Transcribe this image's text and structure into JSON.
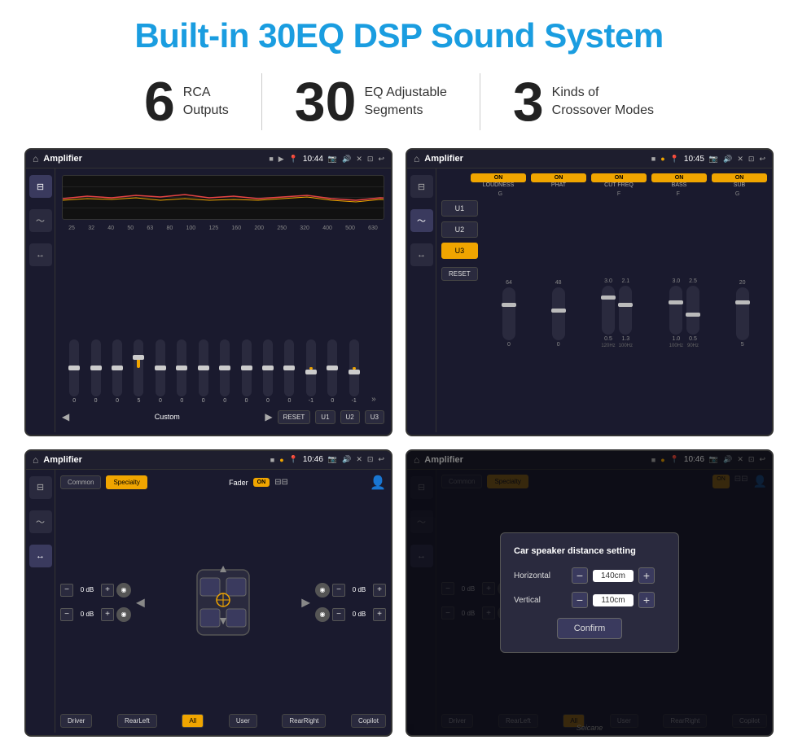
{
  "page": {
    "title": "Built-in 30EQ DSP Sound System",
    "background_color": "#ffffff"
  },
  "features": [
    {
      "number": "6",
      "text_line1": "RCA",
      "text_line2": "Outputs"
    },
    {
      "number": "30",
      "text_line1": "EQ Adjustable",
      "text_line2": "Segments"
    },
    {
      "number": "3",
      "text_line1": "Kinds of",
      "text_line2": "Crossover Modes"
    }
  ],
  "screens": {
    "top_left": {
      "header": {
        "app": "Amplifier",
        "time": "10:44"
      },
      "eq_labels": [
        "25",
        "32",
        "40",
        "50",
        "63",
        "80",
        "100",
        "125",
        "160",
        "200",
        "250",
        "320",
        "400",
        "500",
        "630"
      ],
      "presets": [
        "Custom",
        "RESET",
        "U1",
        "U2",
        "U3"
      ],
      "slider_values": [
        "0",
        "0",
        "0",
        "5",
        "0",
        "0",
        "0",
        "0",
        "0",
        "0",
        "0",
        "-1",
        "0",
        "-1"
      ]
    },
    "top_right": {
      "header": {
        "app": "Amplifier",
        "time": "10:45"
      },
      "u_buttons": [
        "U1",
        "U2",
        "U3"
      ],
      "active_u": "U3",
      "controls": [
        {
          "label": "LOUDNESS",
          "toggle": "ON"
        },
        {
          "label": "PHAT",
          "toggle": "ON"
        },
        {
          "label": "CUT FREQ",
          "toggle": "ON"
        },
        {
          "label": "BASS",
          "toggle": "ON"
        },
        {
          "label": "SUB",
          "toggle": "ON"
        }
      ],
      "reset_label": "RESET"
    },
    "bottom_left": {
      "header": {
        "app": "Amplifier",
        "time": "10:46"
      },
      "tabs": [
        "Common",
        "Specialty"
      ],
      "active_tab": "Specialty",
      "fader_label": "Fader",
      "fader_toggle": "ON",
      "db_values": [
        "0 dB",
        "0 dB",
        "0 dB",
        "0 dB"
      ],
      "speaker_labels": [
        "Driver",
        "RearLeft",
        "All",
        "User",
        "RearRight",
        "Copilot"
      ]
    },
    "bottom_right": {
      "header": {
        "app": "Amplifier",
        "time": "10:46"
      },
      "tabs": [
        "Common",
        "Specialty"
      ],
      "dialog": {
        "title": "Car speaker distance setting",
        "horizontal_label": "Horizontal",
        "horizontal_value": "140cm",
        "vertical_label": "Vertical",
        "vertical_value": "110cm",
        "confirm_label": "Confirm"
      },
      "speaker_labels": [
        "Driver",
        "RearLeft",
        "All",
        "User",
        "RearRight",
        "Copilot"
      ],
      "db_values": [
        "0 dB",
        "0 dB"
      ]
    }
  },
  "watermark": "Seicane",
  "icons": {
    "home": "⌂",
    "back": "↩",
    "camera": "📷",
    "volume": "🔊",
    "close": "✕",
    "minimize": "⊡",
    "play": "▶",
    "prev": "◀",
    "next": "▶",
    "settings": "⚙",
    "up": "▲",
    "down": "▼",
    "left": "◀",
    "right": "▶",
    "eq_icon": "⊟",
    "wave_icon": "〜",
    "speaker_icon": "↔"
  }
}
